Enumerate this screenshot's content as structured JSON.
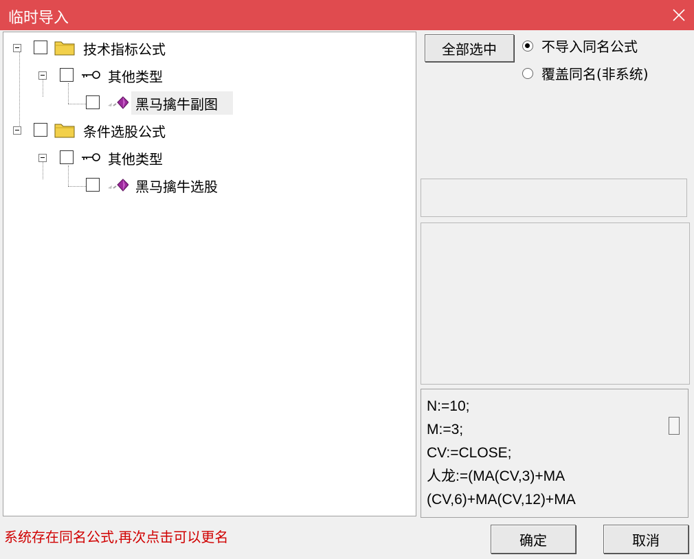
{
  "window": {
    "title": "临时导入"
  },
  "tree": {
    "nodes": [
      {
        "label": "技术指标公式",
        "icon": "folder-icon"
      },
      {
        "label": "其他类型",
        "icon": "key-icon"
      },
      {
        "label": "黑马擒牛副图",
        "icon": "formula-gem-icon",
        "selected": true
      },
      {
        "label": "条件选股公式",
        "icon": "folder-icon"
      },
      {
        "label": "其他类型",
        "icon": "key-icon"
      },
      {
        "label": "黑马擒牛选股",
        "icon": "formula-gem-icon"
      }
    ]
  },
  "right": {
    "select_all_label": "全部选中",
    "options": [
      {
        "label": "不导入同名公式",
        "selected": true
      },
      {
        "label": "覆盖同名(非系统)",
        "selected": false
      }
    ],
    "code_lines": [
      "N:=10;",
      "M:=3;",
      "CV:=CLOSE;",
      "人龙:=(MA(CV,3)+MA",
      "(CV,6)+MA(CV,12)+MA"
    ]
  },
  "footer": {
    "status": "系统存在同名公式,再次点击可以更名",
    "ok_label": "确定",
    "cancel_label": "取消"
  },
  "colors": {
    "titlebar": "#e04b4f",
    "status_text": "#d00000",
    "folder": "#f2d04a",
    "gem": "#9b2a9b"
  }
}
